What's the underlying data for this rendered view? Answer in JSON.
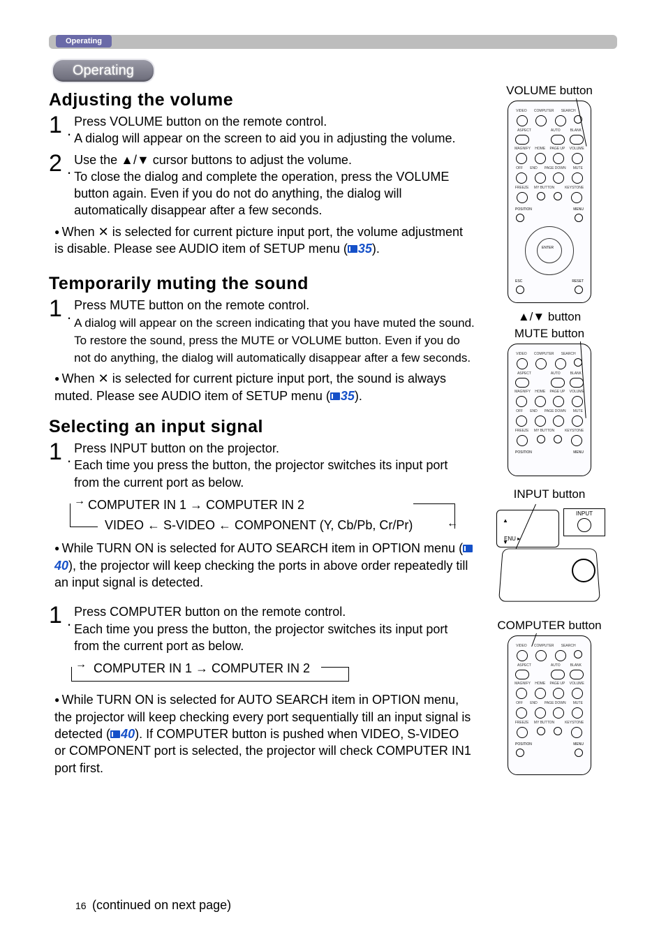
{
  "top_tab": "Operating",
  "section_pill": "Operating",
  "volume": {
    "heading": "Adjusting the volume",
    "step1_a": "Press VOLUME button on the remote control.",
    "step1_b": "A dialog will appear on the screen to aid you in adjusting the volume.",
    "step2_a": "Use the ▲/▼ cursor buttons to adjust the volume.",
    "step2_b": "To close the dialog and complete the operation, press the VOLUME button again. Even if you do not do anything, the dialog will automatically disappear after a few seconds.",
    "bullet_a": "When ",
    "bullet_glyph": "✕",
    "bullet_b": " is selected for current picture input port, the volume adjustment is disable. Please see AUDIO item of SETUP menu (",
    "bullet_ref": "35",
    "bullet_c": ")."
  },
  "mute": {
    "heading": "Temporarily muting the sound",
    "step1_a": "Press MUTE button on the remote control.",
    "step1_b": "A dialog will appear on the screen indicating that you have muted the sound. To restore the sound, press the MUTE or VOLUME button. Even if you do not do anything, the dialog will automatically disappear after a few seconds.",
    "bullet_a": "When ",
    "bullet_glyph": "✕",
    "bullet_b": " is selected for current picture input port, the sound is always muted. Please see AUDIO item of SETUP menu (",
    "bullet_ref": "35",
    "bullet_c": ")."
  },
  "input": {
    "heading": "Selecting an input signal",
    "step1_a": "Press INPUT button on the projector.",
    "step1_b": "Each time you press the button, the projector switches its input port from the current port as below.",
    "flow1_line1": " COMPUTER IN 1 →  COMPUTER IN 2 ",
    "flow1_line2": "VIDEO  ←  S-VIDEO  ←  COMPONENT (Y, Cb/Pb, Cr/Pr)",
    "bullet_a": "While TURN ON is selected for AUTO SEARCH item in OPTION menu (",
    "bullet_ref": "40",
    "bullet_b": "), the projector will keep checking the ports in above order repeatedly till an input signal is detected."
  },
  "computer": {
    "step1_a": "Press COMPUTER button on the remote control.",
    "step1_b": "Each time you press the button, the projector switches its input port from the current port as below.",
    "flow_line": "COMPUTER IN 1 → COMPUTER IN 2",
    "bullet_a": "While TURN ON is selected for AUTO SEARCH item in OPTION menu, the projector will keep checking every port sequentially till an input signal is detected (",
    "bullet_ref": "40",
    "bullet_b": "). If COMPUTER button is pushed when VIDEO, S-VIDEO or COMPONENT port is selected, the projector will check COMPUTER IN1 port first."
  },
  "right": {
    "volume_label": "VOLUME button",
    "arrows_label": "▲/▼ button",
    "mute_label": "MUTE button",
    "input_label": "INPUT button",
    "computer_label": "COMPUTER button",
    "input_box": "INPUT",
    "enu": "ENU"
  },
  "remote_labels": {
    "row1": [
      "VIDEO",
      "COMPUTER",
      "SEARCH",
      ""
    ],
    "row2": [
      "ASPECT",
      "",
      "AUTO",
      "BLANK"
    ],
    "row3": [
      "MAGNIFY",
      "HOME",
      "PAGE UP",
      "VOLUME"
    ],
    "row4": [
      "OFF",
      "END",
      "PAGE DOWN",
      "MUTE"
    ],
    "row5": [
      "FREEZE",
      "MY BUTTON",
      "",
      "KEYSTONE"
    ],
    "dpad": [
      "POSITION",
      "MENU",
      "ENTER",
      "ESC",
      "RESET"
    ]
  },
  "page_number": "16",
  "continued": "(continued on next page)"
}
